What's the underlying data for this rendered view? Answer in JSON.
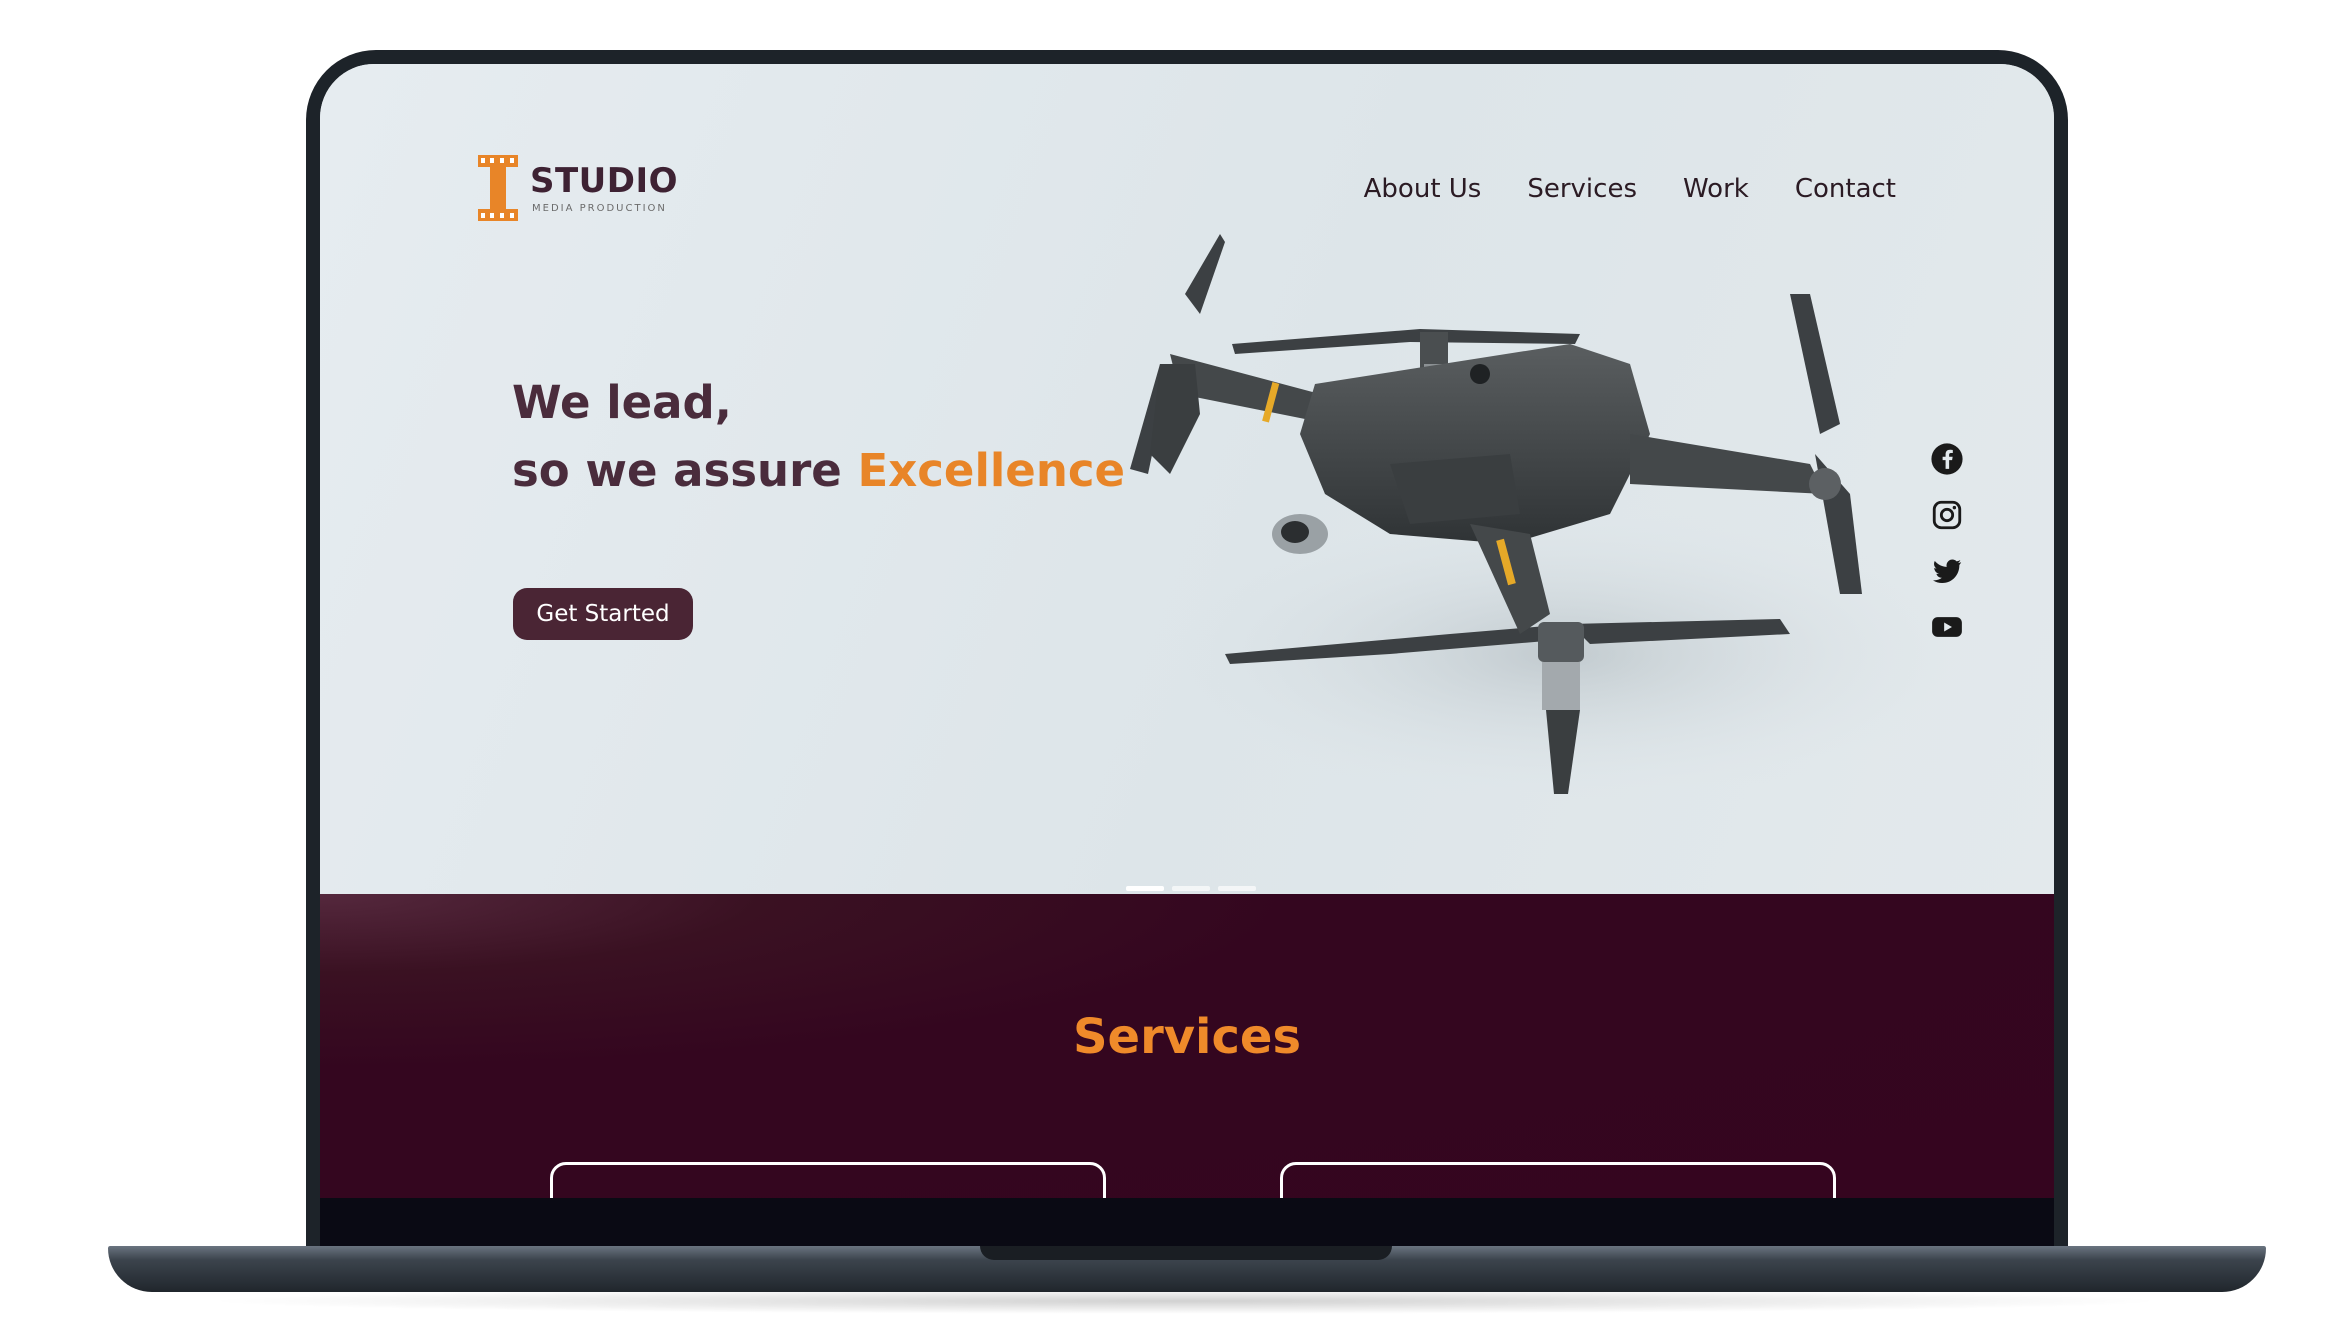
{
  "brand": {
    "name": "STUDIO",
    "tagline": "MEDIA PRODUCTION",
    "primary_color": "#4a2534",
    "accent_color": "#e88528"
  },
  "nav": {
    "items": [
      {
        "label": "About Us"
      },
      {
        "label": "Services"
      },
      {
        "label": "Work"
      },
      {
        "label": "Contact"
      }
    ]
  },
  "hero": {
    "line1": "We lead,",
    "line2_prefix": "so we assure ",
    "line2_accent": "Excellence",
    "cta_label": "Get Started",
    "image": "drone",
    "carousel": {
      "count": 3,
      "active": 1
    }
  },
  "social": {
    "icons": [
      "facebook-icon",
      "instagram-icon",
      "twitter-icon",
      "youtube-icon"
    ]
  },
  "services": {
    "title": "Services"
  }
}
